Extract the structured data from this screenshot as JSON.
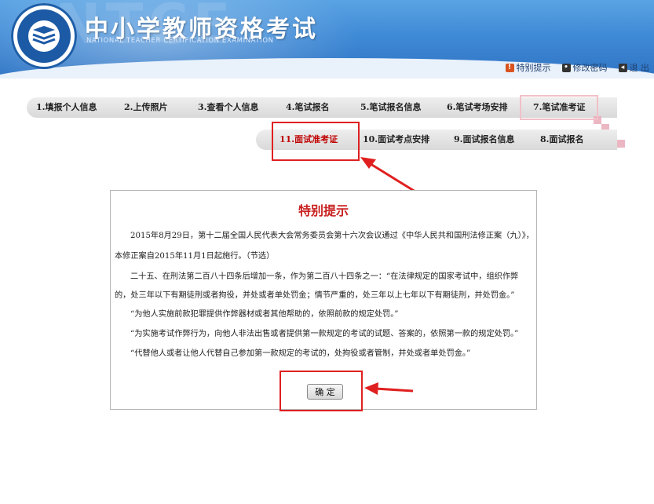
{
  "header": {
    "title_cn": "中小学教师资格考试",
    "title_en": "NATIONAL TEACHER CERTIFICATION EXAMINATION",
    "bg_text": "NTCE",
    "links": [
      {
        "label": "特别提示",
        "icon": "warning-icon",
        "color": "#d9531e"
      },
      {
        "label": "修改密码",
        "icon": "password-icon",
        "color": "#333333"
      },
      {
        "label": "退 出",
        "icon": "logout-icon",
        "color": "#333333"
      }
    ]
  },
  "tabs_row1": [
    {
      "label": "1.填报个人信息"
    },
    {
      "label": "2.上传照片"
    },
    {
      "label": "3.查看个人信息"
    },
    {
      "label": "4.笔试报名"
    },
    {
      "label": "5.笔试报名信息"
    },
    {
      "label": "6.笔试考场安排"
    },
    {
      "label": "7.笔试准考证"
    }
  ],
  "tabs_row2": [
    {
      "label": "11.面试准考证"
    },
    {
      "label": "10.面试考点安排"
    },
    {
      "label": "9.面试报名信息"
    },
    {
      "label": "8.面试报名"
    }
  ],
  "notice": {
    "title": "特别提示",
    "lines": [
      "2015年8月29日，第十二届全国人民代表大会常务委员会第十六次会议通过《中华人民共和国刑法修正案（九）》，",
      "本修正案自2015年11月1日起施行。（节选）",
      "二十五、在刑法第二百八十四条后增加一条，作为第二百八十四条之一：“在法律规定的国家考试中，组织作弊",
      "的，处三年以下有期徒刑或者拘役，并处或者单处罚金；情节严重的，处三年以上七年以下有期徒刑，并处罚金。”",
      "“为他人实施前款犯罪提供作弊器材或者其他帮助的，依照前款的规定处罚。”",
      "“为实施考试作弊行为，向他人非法出售或者提供第一款规定的考试的试题、答案的，依照第一款的规定处罚。”",
      "“代替他人或者让他人代替自己参加第一款规定的考试的，处拘役或者管制，并处或者单处罚金。”"
    ],
    "ok_label": "确 定"
  },
  "colors": {
    "accent_red": "#c82020",
    "header_blue": "#3f8ad6",
    "annotation_red": "#e02020"
  }
}
